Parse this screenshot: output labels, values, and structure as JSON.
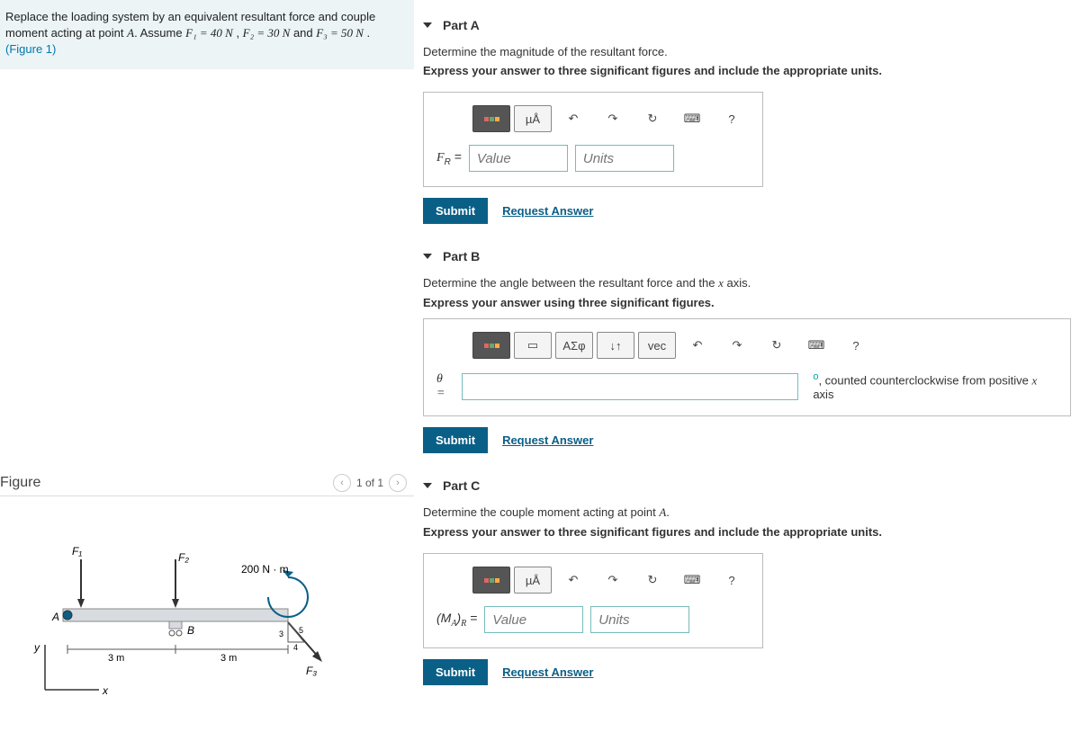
{
  "problem": {
    "text_pre": "Replace the loading system by an equivalent resultant force and couple moment acting at point ",
    "pointA": "A",
    "text_mid": ". Assume ",
    "f1": "F₁ = 40 N",
    "f2": "F₂ = 30 N",
    "f3": "F₃ = 50 N",
    "and1": " , ",
    "and2": " and ",
    "period": " . ",
    "figref": "(Figure 1)"
  },
  "figure": {
    "title": "Figure",
    "pager": "1 of 1",
    "moment_label": "200 N · m",
    "dim1": "3 m",
    "dim2": "3 m",
    "f1": "F₁",
    "f2": "F₂",
    "f3": "F₃",
    "A": "A",
    "B": "B",
    "x": "x",
    "y": "y",
    "s3": "3",
    "s4": "4",
    "s5": "5"
  },
  "parts": {
    "a": {
      "title": "Part A",
      "line1": "Determine the magnitude of the resultant force.",
      "line2": "Express your answer to three significant figures and include the appropriate units.",
      "label": "F",
      "label_sub": "R",
      "eq": " = ",
      "value_ph": "Value",
      "units_ph": "Units"
    },
    "b": {
      "title": "Part B",
      "line1_pre": "Determine the angle between the resultant force and the ",
      "line1_var": "x",
      "line1_post": " axis.",
      "line2": "Express your answer using three significant figures.",
      "label": "θ = ",
      "suffix_pre": ", counted counterclockwise from positive ",
      "suffix_var": "x",
      "suffix_post": " axis"
    },
    "c": {
      "title": "Part C",
      "line1_pre": "Determine the couple moment acting at point ",
      "line1_var": "A",
      "line1_post": ".",
      "line2": "Express your answer to three significant figures and include the appropriate units.",
      "label_pre": "(M",
      "label_sub": "A",
      "label_post": ")",
      "label_sub2": "R",
      "eq": " = ",
      "value_ph": "Value",
      "units_ph": "Units"
    }
  },
  "toolbar": {
    "mu": "µÅ",
    "undo": "↶",
    "redo": "↷",
    "reset": "↻",
    "kbd": "⌨",
    "help": "?",
    "frac": "▭",
    "greek": "ΑΣφ",
    "sort": "↓↑",
    "vec": "vec"
  },
  "actions": {
    "submit": "Submit",
    "request": "Request Answer"
  }
}
